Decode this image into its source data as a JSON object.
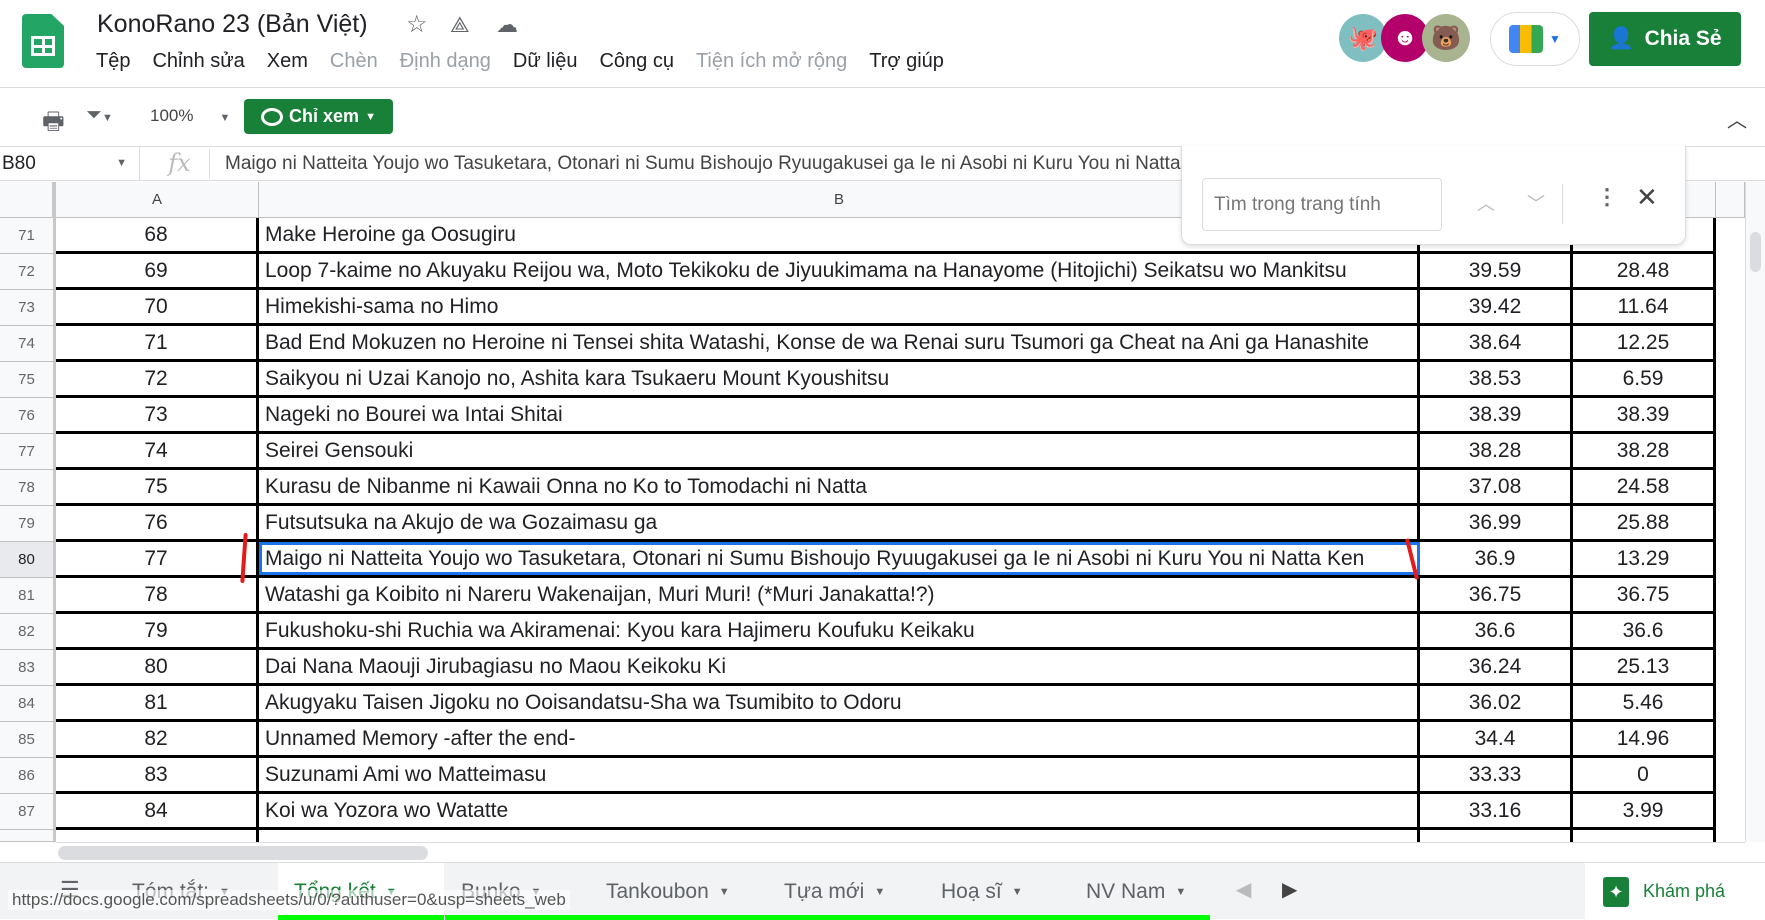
{
  "app": {
    "title": "KonoRano 23 (Bản Việt)",
    "share_label": "Chia Sẻ",
    "brand_color": "#188038"
  },
  "menu": [
    {
      "label": "Tệp",
      "enabled": true
    },
    {
      "label": "Chỉnh sửa",
      "enabled": true
    },
    {
      "label": "Xem",
      "enabled": true
    },
    {
      "label": "Chèn",
      "enabled": false
    },
    {
      "label": "Định dạng",
      "enabled": false
    },
    {
      "label": "Dữ liệu",
      "enabled": true
    },
    {
      "label": "Công cụ",
      "enabled": true
    },
    {
      "label": "Tiện ích mở rộng",
      "enabled": false
    },
    {
      "label": "Trợ giúp",
      "enabled": true
    }
  ],
  "toolbar": {
    "zoom": "100%",
    "mode_label": "Chỉ xem"
  },
  "formula": {
    "cell_ref": "B80",
    "fx": "fx",
    "value": "Maigo ni Natteita Youjo wo Tasuketara, Otonari ni Sumu Bishoujo Ryuugakusei ga Ie ni Asobi ni Kuru You ni Natta Ken"
  },
  "columns": [
    "A",
    "B"
  ],
  "find": {
    "placeholder": "Tìm trong trang tính"
  },
  "selected_row": 80,
  "rows": [
    {
      "n": "71",
      "a": "68",
      "b": "Make Heroine ga Oosugiru",
      "c": "",
      "d": ""
    },
    {
      "n": "72",
      "a": "69",
      "b": "Loop 7-kaime no Akuyaku Reijou wa, Moto Tekikoku de Jiyuukimama na Hanayome (Hitojichi) Seikatsu wo Mankitsu",
      "c": "39.59",
      "d": "28.48"
    },
    {
      "n": "73",
      "a": "70",
      "b": "Himekishi-sama no Himo",
      "c": "39.42",
      "d": "11.64"
    },
    {
      "n": "74",
      "a": "71",
      "b": "Bad End Mokuzen no Heroine ni Tensei shita Watashi, Konse de wa Renai suru Tsumori ga Cheat na Ani ga Hanashite",
      "c": "38.64",
      "d": "12.25"
    },
    {
      "n": "75",
      "a": "72",
      "b": "Saikyou ni Uzai Kanojo no, Ashita kara Tsukaeru Mount Kyoushitsu",
      "c": "38.53",
      "d": "6.59"
    },
    {
      "n": "76",
      "a": "73",
      "b": "Nageki no Bourei wa Intai Shitai",
      "c": "38.39",
      "d": "38.39"
    },
    {
      "n": "77",
      "a": "74",
      "b": "Seirei Gensouki",
      "c": "38.28",
      "d": "38.28"
    },
    {
      "n": "78",
      "a": "75",
      "b": "Kurasu de Nibanme ni Kawaii Onna no Ko to Tomodachi ni Natta",
      "c": "37.08",
      "d": "24.58"
    },
    {
      "n": "79",
      "a": "76",
      "b": "Futsutsuka na Akujo de wa Gozaimasu ga",
      "c": "36.99",
      "d": "25.88"
    },
    {
      "n": "80",
      "a": "77",
      "b": "Maigo ni Natteita Youjo wo Tasuketara, Otonari ni Sumu Bishoujo Ryuugakusei ga Ie ni Asobi ni Kuru You ni Natta Ken",
      "c": "36.9",
      "d": "13.29"
    },
    {
      "n": "81",
      "a": "78",
      "b": "Watashi ga Koibito ni Nareru Wakenaijan, Muri Muri! (*Muri Janakatta!?)",
      "c": "36.75",
      "d": "36.75"
    },
    {
      "n": "82",
      "a": "79",
      "b": "Fukushoku-shi Ruchia wa Akiramenai: Kyou kara Hajimeru Koufuku Keikaku",
      "c": "36.6",
      "d": "36.6"
    },
    {
      "n": "83",
      "a": "80",
      "b": "Dai Nana Maouji Jirubagiasu no Maou Keikoku Ki",
      "c": "36.24",
      "d": "25.13"
    },
    {
      "n": "84",
      "a": "81",
      "b": "Akugyaku Taisen Jigoku no Ooisandatsu-Sha wa Tsumibito to Odoru",
      "c": "36.02",
      "d": "5.46"
    },
    {
      "n": "85",
      "a": "82",
      "b": "Unnamed Memory -after the end-",
      "c": "34.4",
      "d": "14.96"
    },
    {
      "n": "86",
      "a": "83",
      "b": "Suzunami Ami wo Matteimasu",
      "c": "33.33",
      "d": "0"
    },
    {
      "n": "87",
      "a": "84",
      "b": "Koi wa Yozora wo Watatte",
      "c": "33.16",
      "d": "3.99"
    }
  ],
  "sheets": [
    {
      "label": "Tóm tắt:",
      "active": false
    },
    {
      "label": "Tổng kết",
      "active": true
    },
    {
      "label": "Bunko",
      "active": false
    },
    {
      "label": "Tankoubon",
      "active": false
    },
    {
      "label": "Tựa mới",
      "active": false
    },
    {
      "label": "Hoạ sĩ",
      "active": false
    },
    {
      "label": "NV Nam",
      "active": false
    }
  ],
  "explore_label": "Khám phá",
  "status_url": "https://docs.google.com/spreadsheets/u/0/?authuser=0&usp=sheets_web"
}
